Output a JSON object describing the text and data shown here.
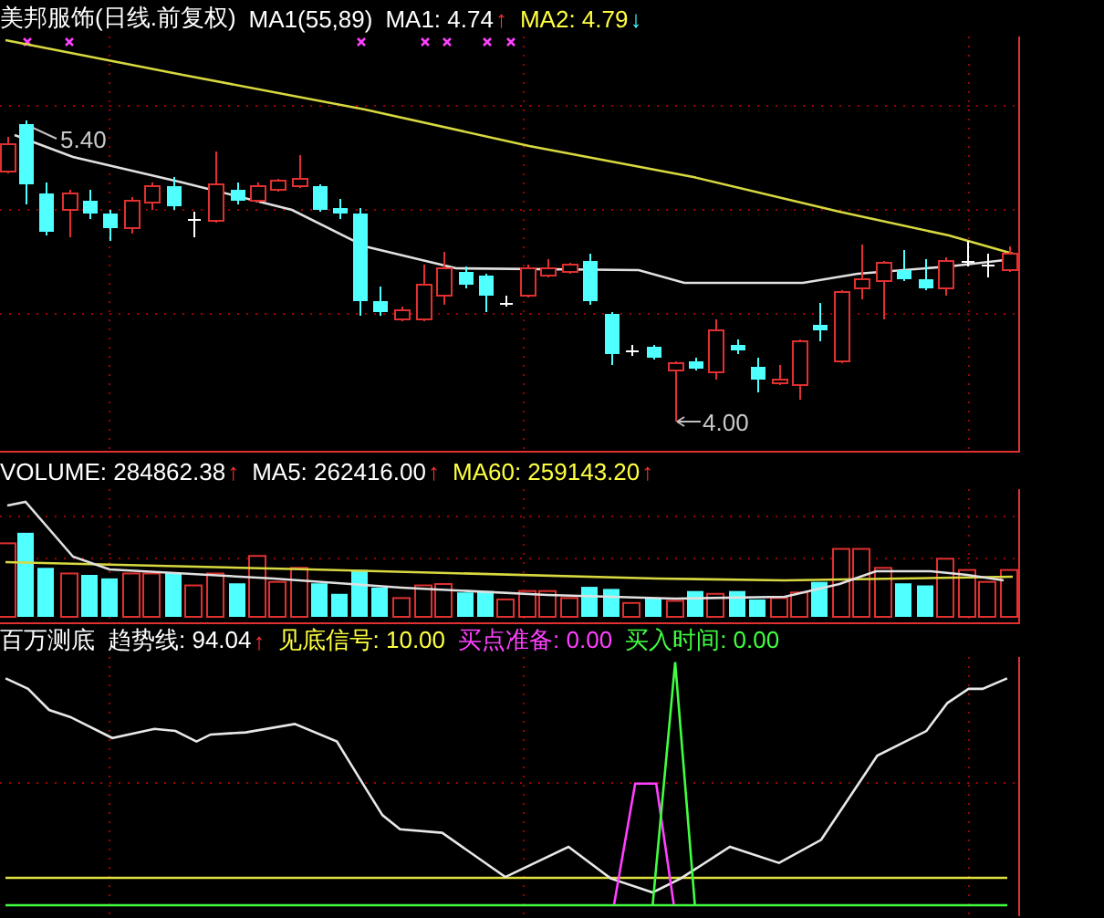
{
  "price_panel": {
    "legend": [
      {
        "text": "美邦服饰(日线.前复权)",
        "color": "#ffffff"
      },
      {
        "text": "MA1(55,89)",
        "color": "#ffffff"
      },
      {
        "text": "MA1: 4.74",
        "color": "#ffffff",
        "arrow": "↑",
        "rising": true
      },
      {
        "text": "MA2: 4.79",
        "color": "#ffff40",
        "arrow": "↓",
        "rising": false
      }
    ],
    "annotations": [
      {
        "kind": "high",
        "text": "5.40"
      },
      {
        "kind": "low",
        "text": "4.00"
      }
    ]
  },
  "volume_panel": {
    "legend": [
      {
        "text": "VOLUME: 284862.38",
        "color": "#ffffff",
        "arrow": "↑",
        "rising": true
      },
      {
        "text": "MA5: 262416.00",
        "color": "#ffffff",
        "arrow": "↑",
        "rising": true
      },
      {
        "text": "MA60: 259143.20",
        "color": "#ffff40",
        "arrow": "↑",
        "rising": true
      }
    ]
  },
  "indicator_panel": {
    "legend": [
      {
        "text": "百万测底",
        "color": "#ffffff"
      },
      {
        "text": "趋势线: 94.04",
        "color": "#ffffff",
        "arrow": "↑",
        "rising": true
      },
      {
        "text": "见底信号: 10.00",
        "color": "#ffff40"
      },
      {
        "text": "买点准备: 0.00",
        "color": "#ff40ff"
      },
      {
        "text": "买入时间: 0.00",
        "color": "#40ff40"
      }
    ]
  }
}
